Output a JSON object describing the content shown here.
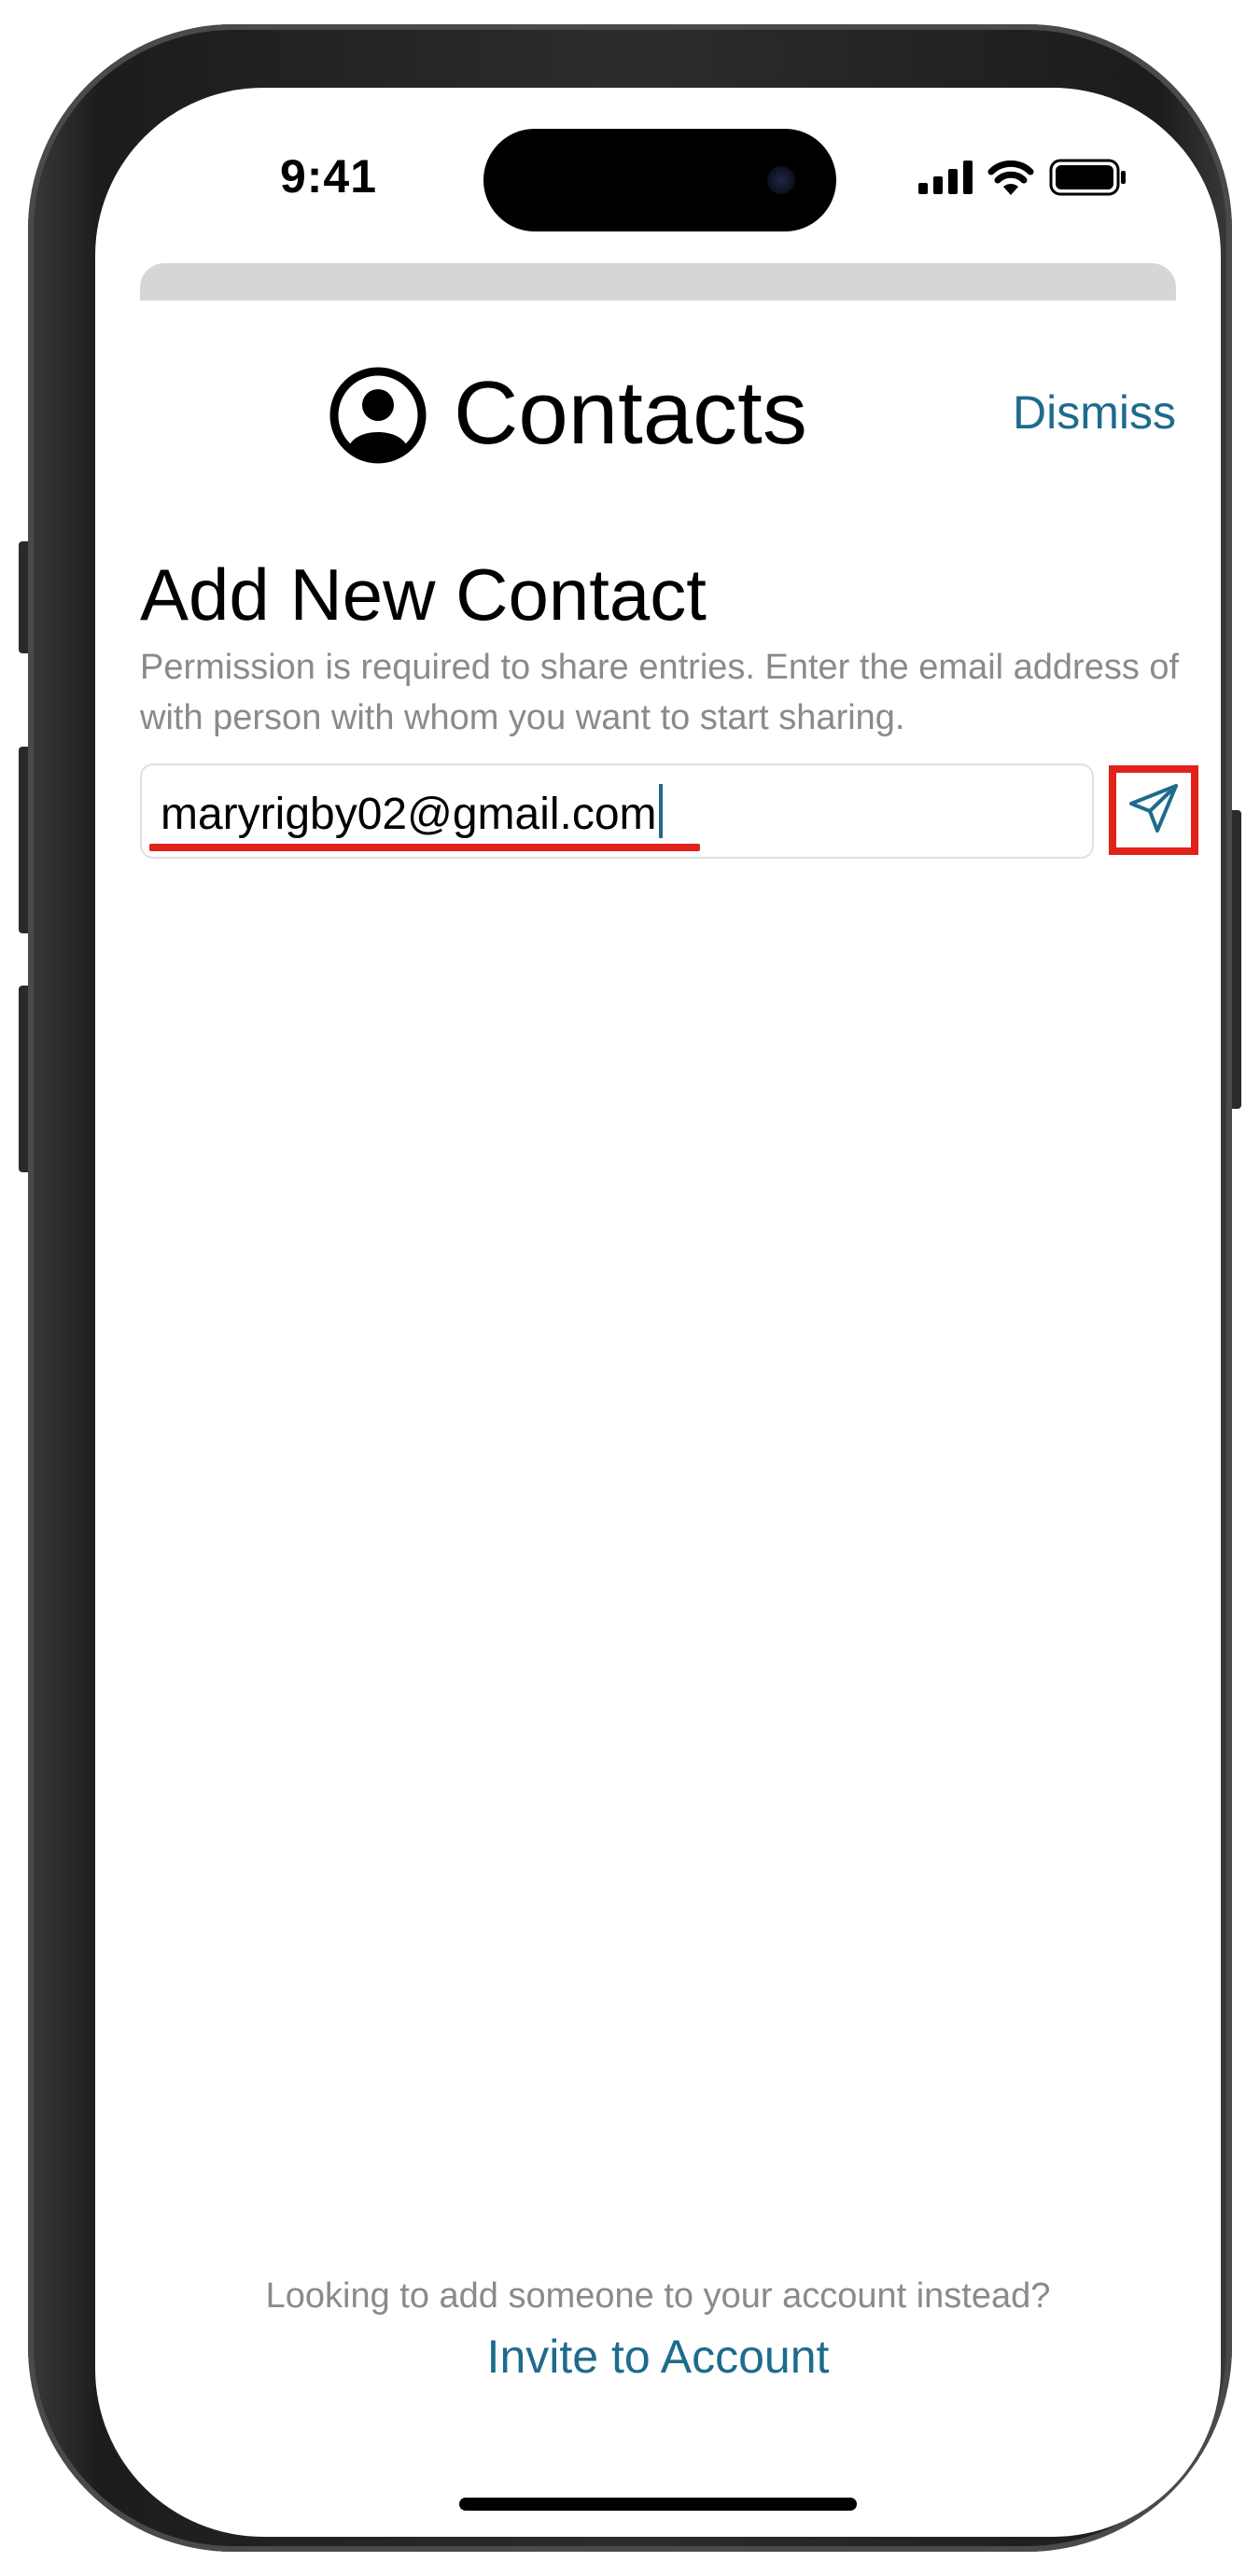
{
  "status_bar": {
    "time": "9:41",
    "icons": [
      "cellular-signal-icon",
      "wifi-icon",
      "battery-icon"
    ]
  },
  "header": {
    "icon": "person-circle-icon",
    "title": "Contacts",
    "dismiss_label": "Dismiss"
  },
  "form": {
    "section_title": "Add New Contact",
    "helper_text": "Permission is required to share entries. Enter the email address of with person with whom you want to start sharing.",
    "email_value": "maryrigby02@gmail.com",
    "send_icon": "paper-plane-icon"
  },
  "footer": {
    "question": "Looking to add someone to your account instead?",
    "link_label": "Invite to Account"
  },
  "colors": {
    "accent": "#1e6b8c",
    "highlight": "#e0221b",
    "secondary_text": "#8a8a8e"
  }
}
